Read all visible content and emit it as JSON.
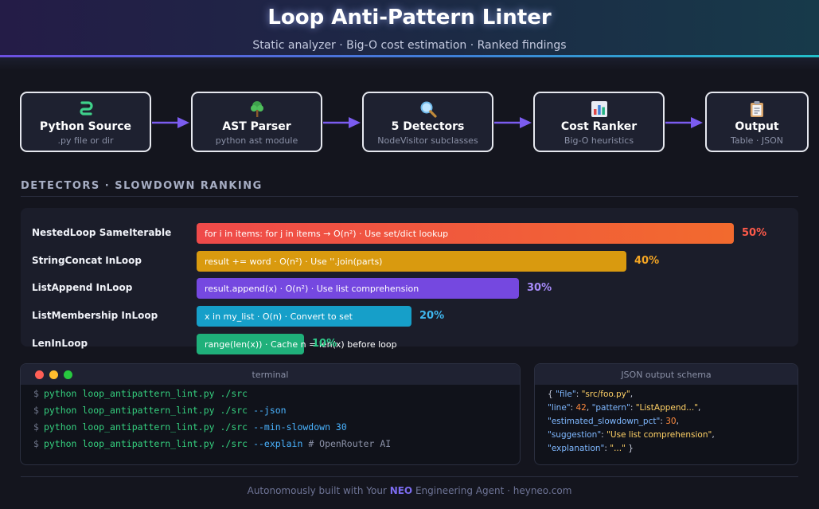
{
  "header": {
    "title": "Loop Anti-Pattern Linter",
    "subtitle": "Static analyzer · Big-O cost estimation · Ranked findings"
  },
  "pipeline": [
    {
      "title": "Python Source",
      "subtitle": ".py file or dir",
      "icon": "snake-icon",
      "color": "#7b5cf0"
    },
    {
      "title": "AST Parser",
      "subtitle": "python ast module",
      "icon": "tree-icon",
      "color": "#1fb6e6"
    },
    {
      "title": "5 Detectors",
      "subtitle": "NodeVisitor subclasses",
      "icon": "magnifier-icon",
      "color": "#e0a020"
    },
    {
      "title": "Cost Ranker",
      "subtitle": "Big-O heuristics",
      "icon": "bar-chart-icon",
      "color": "#e04848"
    },
    {
      "title": "Output",
      "subtitle": "Table · JSON",
      "icon": "clipboard-icon",
      "color": "#25b384"
    }
  ],
  "detectors": {
    "section_title": "DETECTORS · SLOWDOWN RANKING",
    "items": [
      {
        "name": "NestedLoop SameIterable",
        "description": "for i in items: for j in items → O(n²) · Use set/dict lookup",
        "slowdown_pct": 50,
        "pct_label": "50%",
        "color": "#ef4a4a",
        "color2": "#f26a2e",
        "pct_color": "#ff5a4a"
      },
      {
        "name": "StringConcat InLoop",
        "description": "result += word · O(n²) · Use ''.join(parts)",
        "slowdown_pct": 40,
        "pct_label": "40%",
        "color": "#d99a0f",
        "color2": "#d99a0f",
        "pct_color": "#f5a623"
      },
      {
        "name": "ListAppend InLoop",
        "description": "result.append(x) · O(n²) · Use list comprehension",
        "slowdown_pct": 30,
        "pct_label": "30%",
        "color": "#7548e0",
        "color2": "#7548e0",
        "pct_color": "#a78bfa"
      },
      {
        "name": "ListMembership InLoop",
        "description": "x in my_list · O(n) · Convert to set",
        "slowdown_pct": 20,
        "pct_label": "20%",
        "color": "#169fc9",
        "color2": "#169fc9",
        "pct_color": "#3fb8f0"
      },
      {
        "name": "LenInLoop",
        "description": "range(len(x)) · Cache n = len(x) before loop",
        "slowdown_pct": 10,
        "pct_label": "10%",
        "color": "#1fb07a",
        "color2": "#1fb07a",
        "pct_color": "#2ecc8a"
      }
    ]
  },
  "terminal": {
    "title": "terminal",
    "prompt": "$",
    "lines": [
      {
        "cmd": "python loop_antipattern_lint.py ./src",
        "flag": "",
        "comment": ""
      },
      {
        "cmd": "python loop_antipattern_lint.py ./src",
        "flag": "--json",
        "comment": ""
      },
      {
        "cmd": "python loop_antipattern_lint.py ./src",
        "flag": "--min-slowdown 30",
        "comment": ""
      },
      {
        "cmd": "python loop_antipattern_lint.py ./src",
        "flag": "--explain",
        "comment": "# OpenRouter AI"
      }
    ]
  },
  "json_schema": {
    "title": "JSON output schema",
    "file": "\"src/foo.py\"",
    "line": "42",
    "pattern": "\"ListAppend...\"",
    "estimated_slowdown_pct": "30",
    "suggestion": "\"Use list comprehension\"",
    "explanation": "\"...\""
  },
  "footer": {
    "prefix": "Autonomously built with ",
    "brand": "NEO",
    "brand_prefix": "Your ",
    "suffix": " Engineering Agent · heyneo.com"
  }
}
